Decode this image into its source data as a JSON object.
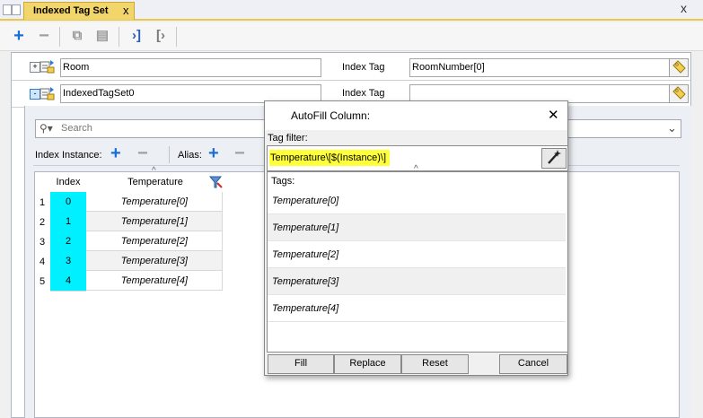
{
  "tab": {
    "title": "Indexed Tag Set",
    "close": "x"
  },
  "window": {
    "close": "x"
  },
  "rows": [
    {
      "expander": "+",
      "name": "Room",
      "index_tag_label": "Index Tag",
      "index_tag_value": "RoomNumber[0]"
    },
    {
      "expander": "-",
      "name": "IndexedTagSet0",
      "index_tag_label": "Index Tag",
      "index_tag_value": ""
    }
  ],
  "search": {
    "placeholder": "Search"
  },
  "instance_bar": {
    "index_instance_label": "Index Instance:",
    "alias_label": "Alias:"
  },
  "grid": {
    "columns": [
      "Index",
      "Temperature"
    ],
    "rows": [
      {
        "num": "1",
        "index": "0",
        "temp": "Temperature[0]"
      },
      {
        "num": "2",
        "index": "1",
        "temp": "Temperature[1]"
      },
      {
        "num": "3",
        "index": "2",
        "temp": "Temperature[2]"
      },
      {
        "num": "4",
        "index": "3",
        "temp": "Temperature[3]"
      },
      {
        "num": "5",
        "index": "4",
        "temp": "Temperature[4]"
      }
    ]
  },
  "dialog": {
    "title": "AutoFill Column:",
    "close": "✕",
    "tag_filter_label": "Tag filter:",
    "tag_filter_value": "Temperature\\[$(Instance)\\]",
    "tags_label": "Tags:",
    "tags": [
      "Temperature[0]",
      "Temperature[1]",
      "Temperature[2]",
      "Temperature[3]",
      "Temperature[4]"
    ],
    "buttons": {
      "fill": "Fill",
      "replace": "Replace",
      "reset": "Reset",
      "cancel": "Cancel"
    }
  },
  "colors": {
    "accent": "#1a6fd6",
    "tab": "#f3d66b",
    "index_highlight": "#00f0ff",
    "filter_highlight": "#ffff3a"
  },
  "icons": [
    "add-icon",
    "remove-icon",
    "copy-icon",
    "paste-icon",
    "expand-icon",
    "collapse-icon",
    "search-icon",
    "tag-browse-icon",
    "magic-wand-icon",
    "filter-clear-icon"
  ]
}
